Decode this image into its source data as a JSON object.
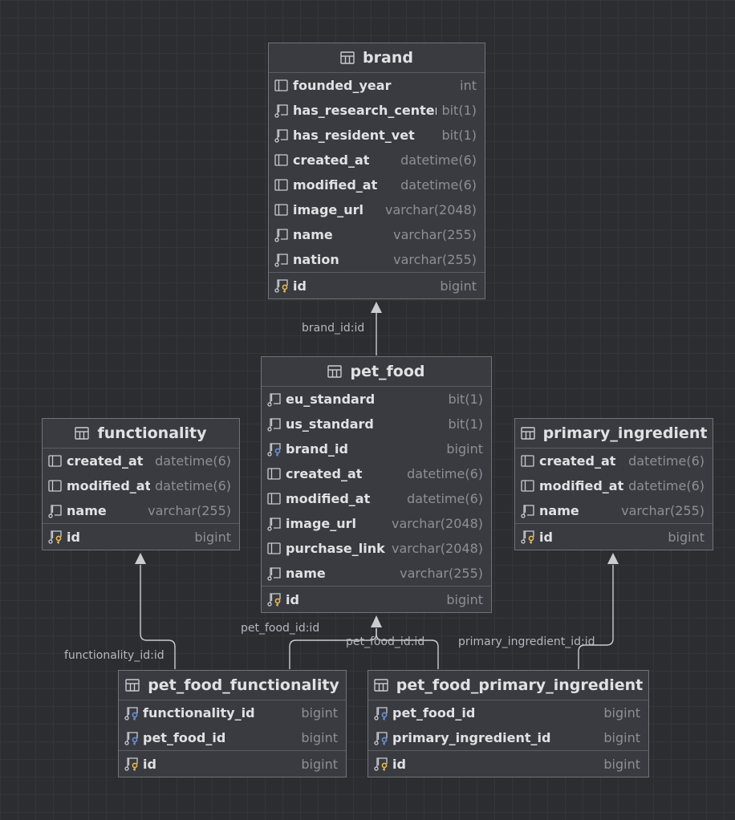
{
  "tables": {
    "brand": {
      "title": "brand",
      "columns": [
        {
          "name": "founded_year",
          "type": "int",
          "icon": "column-icon"
        },
        {
          "name": "has_research_center",
          "type": "bit(1)",
          "icon": "not-null-column-icon"
        },
        {
          "name": "has_resident_vet",
          "type": "bit(1)",
          "icon": "not-null-column-icon"
        },
        {
          "name": "created_at",
          "type": "datetime(6)",
          "icon": "column-icon"
        },
        {
          "name": "modified_at",
          "type": "datetime(6)",
          "icon": "column-icon"
        },
        {
          "name": "image_url",
          "type": "varchar(2048)",
          "icon": "column-icon"
        },
        {
          "name": "name",
          "type": "varchar(255)",
          "icon": "not-null-column-icon"
        },
        {
          "name": "nation",
          "type": "varchar(255)",
          "icon": "not-null-column-icon"
        }
      ],
      "pk": {
        "name": "id",
        "type": "bigint",
        "icon": "primary-key-icon"
      }
    },
    "pet_food": {
      "title": "pet_food",
      "columns": [
        {
          "name": "eu_standard",
          "type": "bit(1)",
          "icon": "not-null-column-icon"
        },
        {
          "name": "us_standard",
          "type": "bit(1)",
          "icon": "not-null-column-icon"
        },
        {
          "name": "brand_id",
          "type": "bigint",
          "icon": "foreign-key-icon"
        },
        {
          "name": "created_at",
          "type": "datetime(6)",
          "icon": "column-icon"
        },
        {
          "name": "modified_at",
          "type": "datetime(6)",
          "icon": "column-icon"
        },
        {
          "name": "image_url",
          "type": "varchar(2048)",
          "icon": "not-null-column-icon"
        },
        {
          "name": "purchase_link",
          "type": "varchar(2048)",
          "icon": "column-icon"
        },
        {
          "name": "name",
          "type": "varchar(255)",
          "icon": "not-null-column-icon"
        }
      ],
      "pk": {
        "name": "id",
        "type": "bigint",
        "icon": "primary-key-icon"
      }
    },
    "functionality": {
      "title": "functionality",
      "columns": [
        {
          "name": "created_at",
          "type": "datetime(6)",
          "icon": "column-icon"
        },
        {
          "name": "modified_at",
          "type": "datetime(6)",
          "icon": "column-icon"
        },
        {
          "name": "name",
          "type": "varchar(255)",
          "icon": "not-null-column-icon"
        }
      ],
      "pk": {
        "name": "id",
        "type": "bigint",
        "icon": "primary-key-icon"
      }
    },
    "primary_ingredient": {
      "title": "primary_ingredient",
      "columns": [
        {
          "name": "created_at",
          "type": "datetime(6)",
          "icon": "column-icon"
        },
        {
          "name": "modified_at",
          "type": "datetime(6)",
          "icon": "column-icon"
        },
        {
          "name": "name",
          "type": "varchar(255)",
          "icon": "not-null-column-icon"
        }
      ],
      "pk": {
        "name": "id",
        "type": "bigint",
        "icon": "primary-key-icon"
      }
    },
    "pet_food_functionality": {
      "title": "pet_food_functionality",
      "columns": [
        {
          "name": "functionality_id",
          "type": "bigint",
          "icon": "foreign-key-icon"
        },
        {
          "name": "pet_food_id",
          "type": "bigint",
          "icon": "foreign-key-icon"
        }
      ],
      "pk": {
        "name": "id",
        "type": "bigint",
        "icon": "primary-key-icon"
      }
    },
    "pet_food_primary_ingredient": {
      "title": "pet_food_primary_ingredient",
      "columns": [
        {
          "name": "pet_food_id",
          "type": "bigint",
          "icon": "foreign-key-icon"
        },
        {
          "name": "primary_ingredient_id",
          "type": "bigint",
          "icon": "foreign-key-icon"
        }
      ],
      "pk": {
        "name": "id",
        "type": "bigint",
        "icon": "primary-key-icon"
      }
    }
  },
  "relations": {
    "brand_fk": "brand_id:id",
    "functionality_fk": "functionality_id:id",
    "pet_food_fk_1": "pet_food_id:id",
    "pet_food_fk_2": "pet_food_id:id",
    "primary_ingredient_fk": "primary_ingredient_id:id"
  },
  "colors": {
    "background": "#2b2d30",
    "table_bg": "#393b40",
    "table_border": "#6f737a",
    "text": "#dfe1e5",
    "type_text": "#8c9096",
    "edge": "#c9ccd1",
    "pk_key": "#e8b84a",
    "fk_key": "#6b8fd6"
  }
}
